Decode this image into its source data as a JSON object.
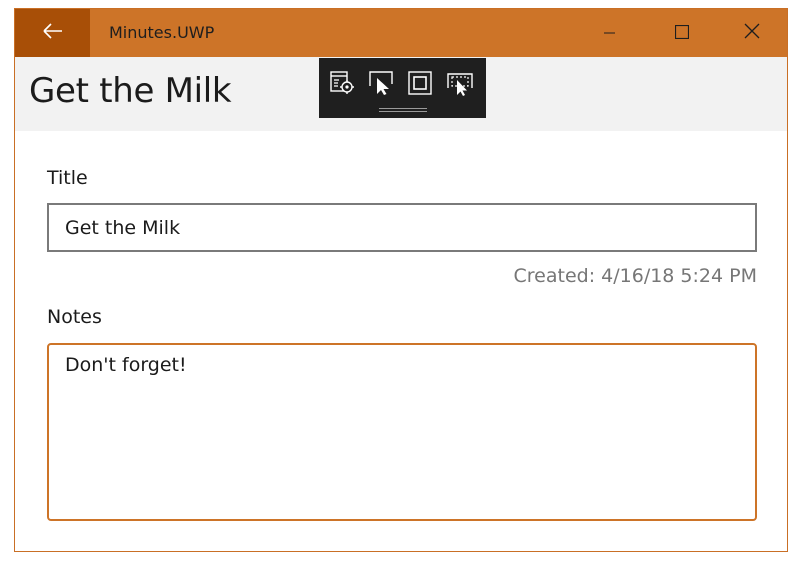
{
  "window": {
    "app_title": "Minutes.UWP",
    "accent_color": "#cd7428",
    "back_button_color": "#a84f07"
  },
  "titlebar": {
    "back_icon": "arrow-left-icon",
    "minimize_icon": "minimize-icon",
    "maximize_icon": "maximize-icon",
    "close_icon": "close-icon"
  },
  "header": {
    "page_title": "Get the Milk"
  },
  "debug_toolbar": {
    "icons": [
      "live-visual-tree-icon",
      "select-element-icon",
      "display-layout-adorners-icon",
      "track-focused-element-icon"
    ]
  },
  "form": {
    "title_label": "Title",
    "title_value": "Get the Milk",
    "created_text": "Created: 4/16/18 5:24 PM",
    "notes_label": "Notes",
    "notes_value": "Don't forget!"
  }
}
